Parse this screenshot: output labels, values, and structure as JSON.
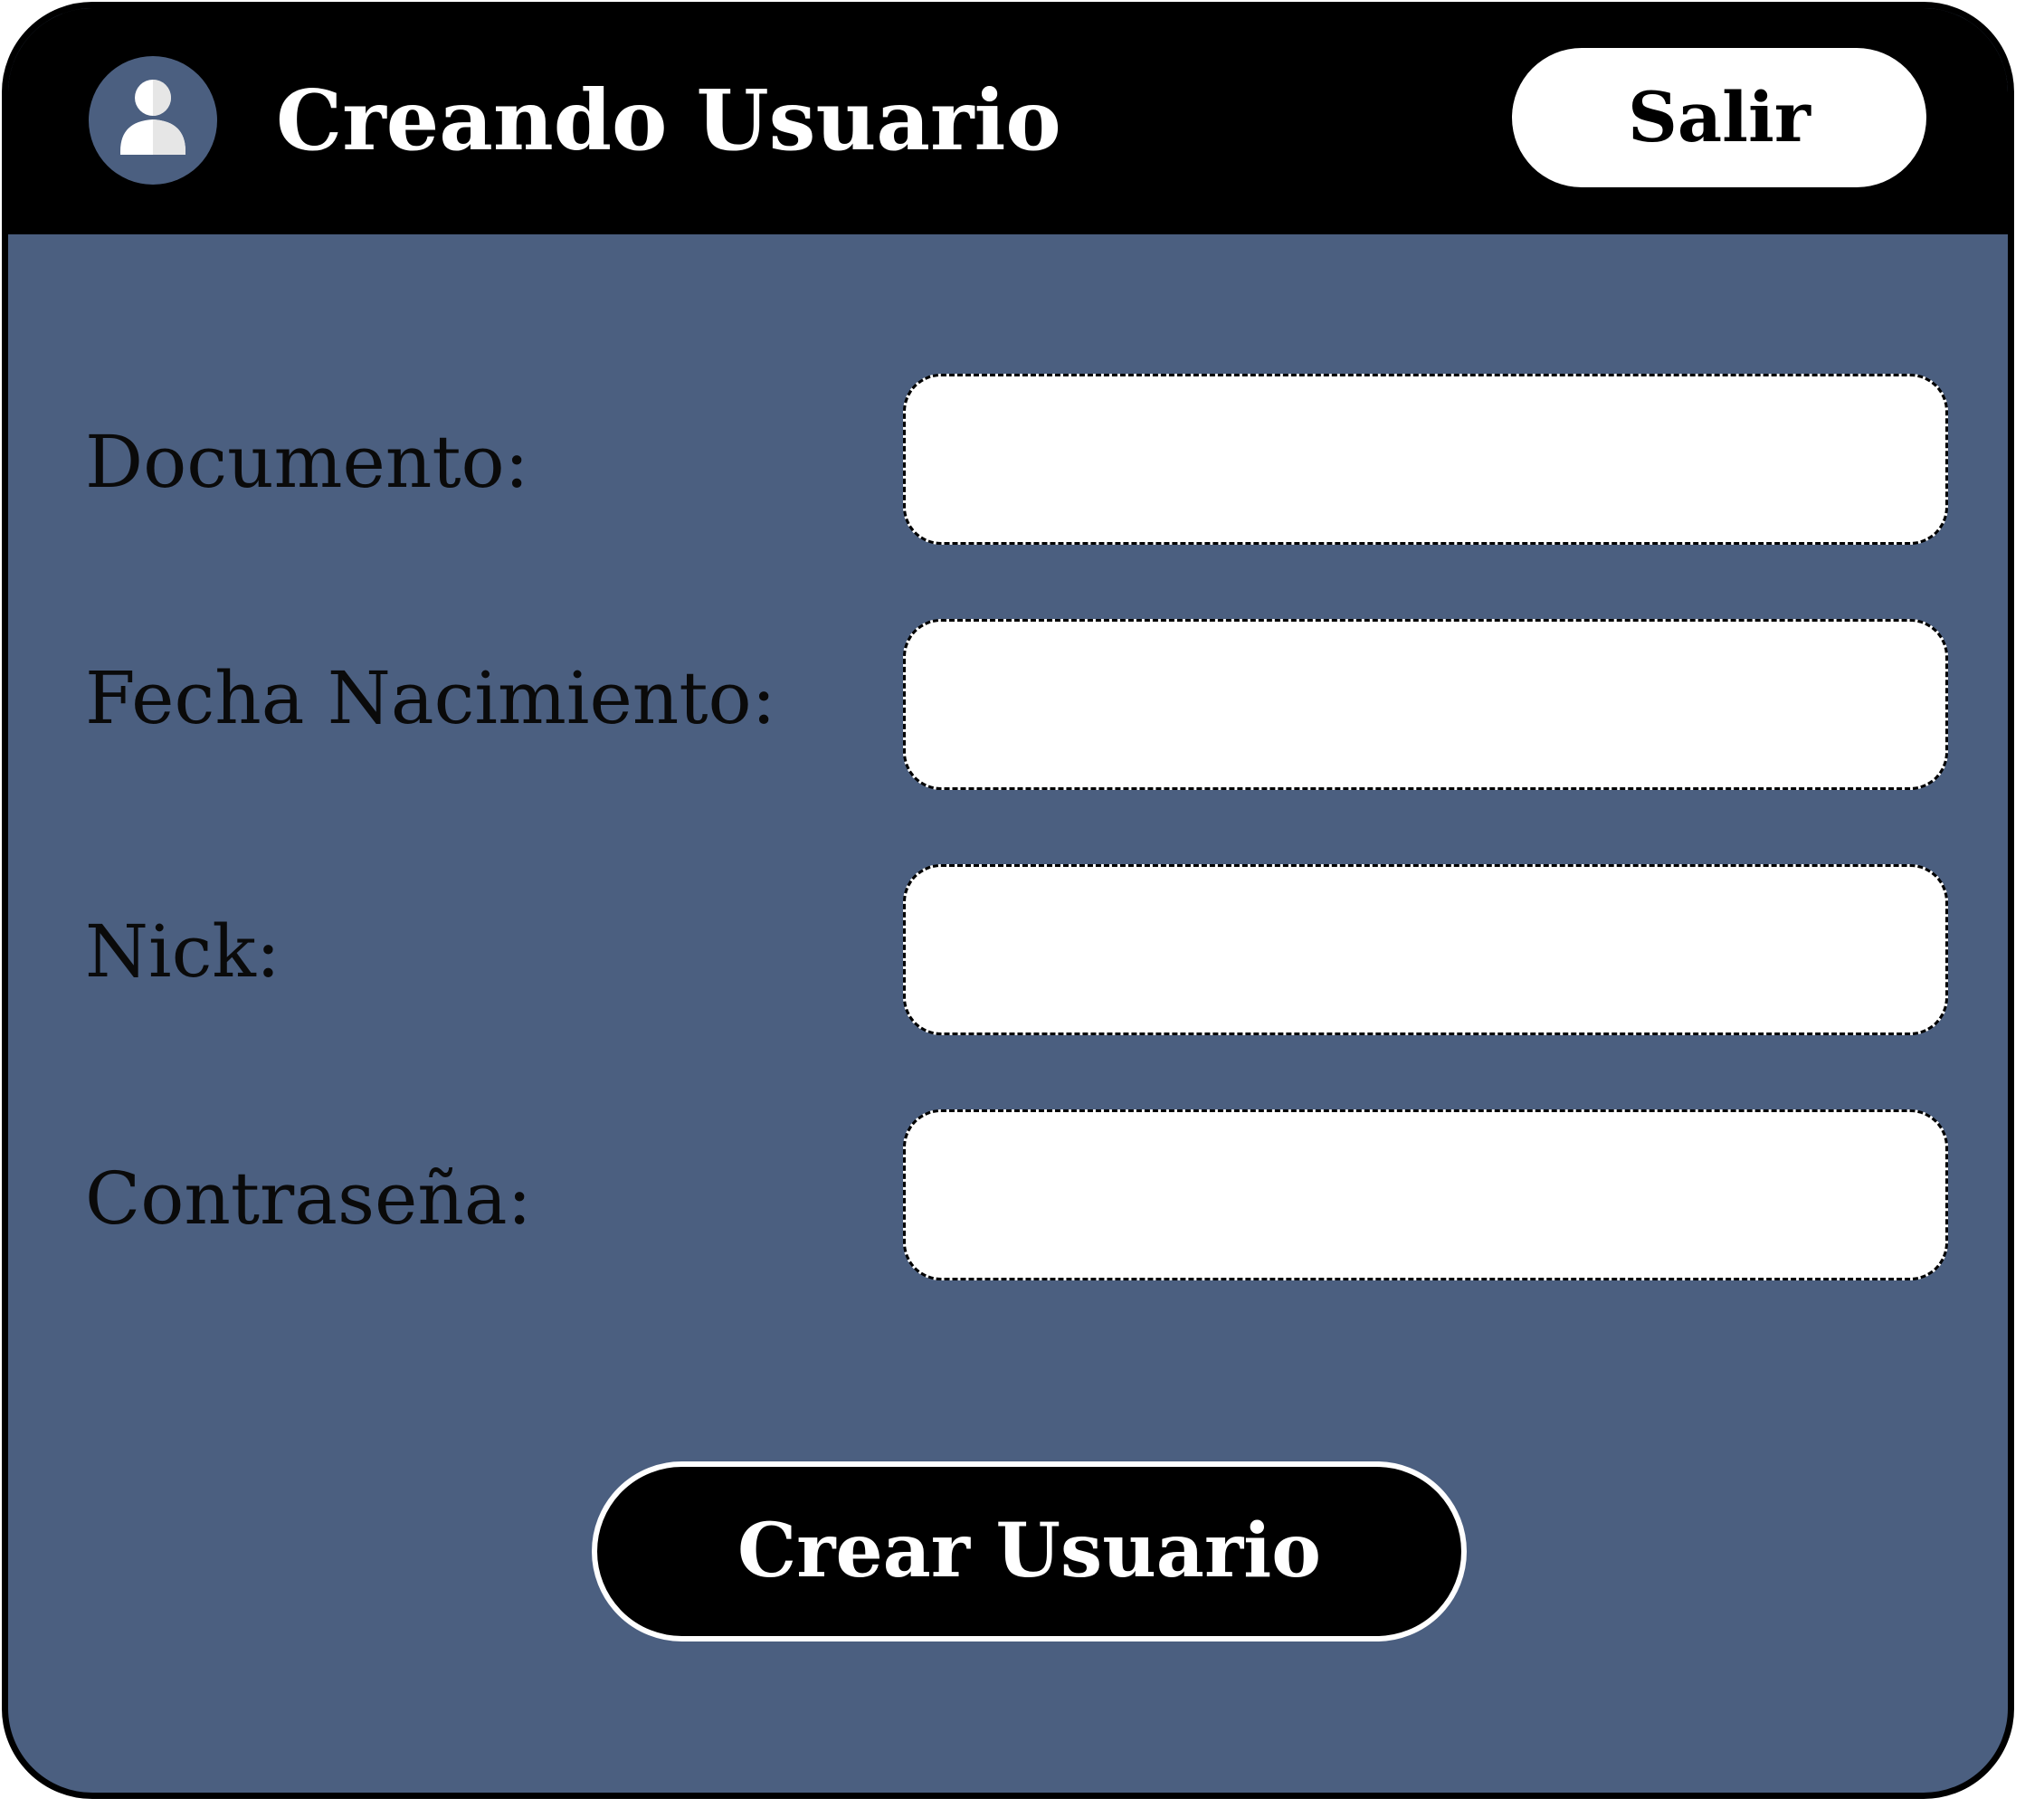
{
  "header": {
    "title": "Creando Usuario",
    "avatar_icon": "user-icon",
    "exit_label": "Salir"
  },
  "form": {
    "fields": [
      {
        "label": "Documento:",
        "value": ""
      },
      {
        "label": "Fecha Nacimiento:",
        "value": ""
      },
      {
        "label": "Nick:",
        "value": ""
      },
      {
        "label": "Contraseña:",
        "value": ""
      }
    ],
    "submit_label": "Crear Usuario"
  },
  "colors": {
    "background": "#4b5f80",
    "header": "#000000",
    "input_background": "#ffffff",
    "button_background": "#000000",
    "button_text": "#ffffff"
  }
}
